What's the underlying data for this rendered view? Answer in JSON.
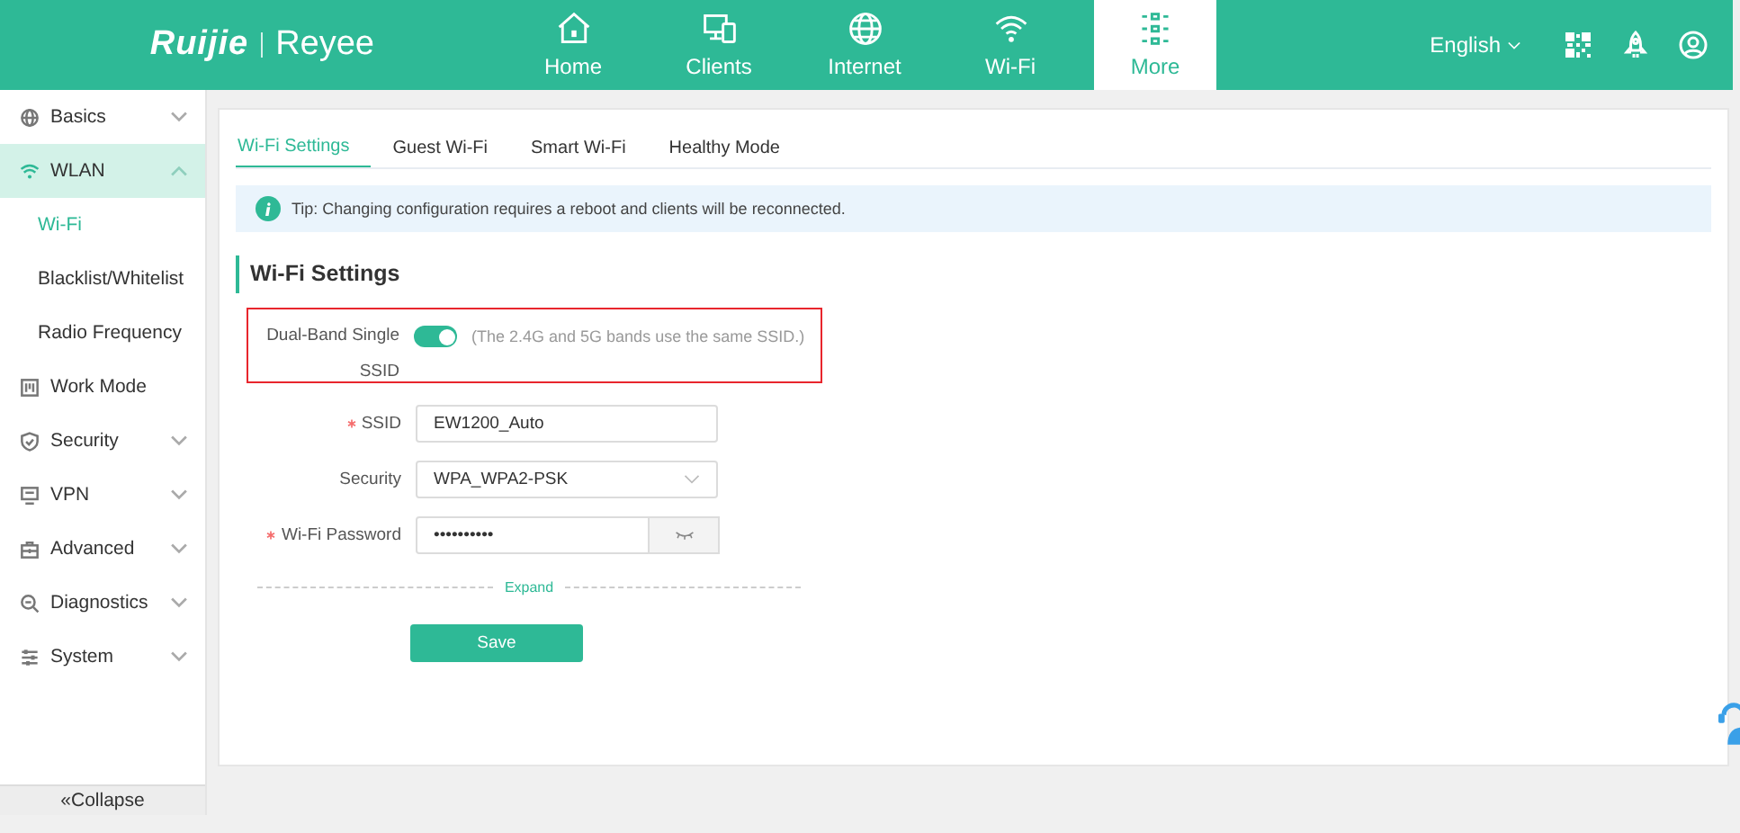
{
  "header": {
    "logo": {
      "brand": "Ruijie",
      "sub": "Reyee"
    },
    "nav": [
      {
        "label": "Home",
        "selected": false
      },
      {
        "label": "Clients",
        "selected": false
      },
      {
        "label": "Internet",
        "selected": false
      },
      {
        "label": "Wi-Fi",
        "selected": false
      },
      {
        "label": "More",
        "selected": true
      }
    ],
    "language": "English"
  },
  "sidebar": {
    "items": [
      {
        "label": "Basics",
        "kind": "group",
        "expanded": false,
        "selected": false
      },
      {
        "label": "WLAN",
        "kind": "group",
        "expanded": true,
        "selected": true,
        "children": [
          {
            "label": "Wi-Fi",
            "selected": true
          },
          {
            "label": "Blacklist/Whitelist",
            "selected": false
          },
          {
            "label": "Radio Frequency",
            "selected": false
          }
        ]
      },
      {
        "label": "Work Mode",
        "kind": "link",
        "selected": false
      },
      {
        "label": "Security",
        "kind": "group",
        "expanded": false,
        "selected": false
      },
      {
        "label": "VPN",
        "kind": "group",
        "expanded": false,
        "selected": false
      },
      {
        "label": "Advanced",
        "kind": "group",
        "expanded": false,
        "selected": false
      },
      {
        "label": "Diagnostics",
        "kind": "group",
        "expanded": false,
        "selected": false
      },
      {
        "label": "System",
        "kind": "group",
        "expanded": false,
        "selected": false
      }
    ],
    "collapse": "«Collapse"
  },
  "content": {
    "tabs": [
      {
        "label": "Wi-Fi Settings",
        "selected": true
      },
      {
        "label": "Guest Wi-Fi",
        "selected": false
      },
      {
        "label": "Smart Wi-Fi",
        "selected": false
      },
      {
        "label": "Healthy Mode",
        "selected": false
      }
    ],
    "tip": "Tip: Changing configuration requires a reboot and clients will be reconnected.",
    "section_title": "Wi-Fi Settings",
    "fields": [
      {
        "kind": "toggle",
        "label": "Dual-Band Single SSID",
        "required": false,
        "highlighted": true,
        "on": true,
        "hint": "(The 2.4G and 5G bands use the same SSID.)"
      },
      {
        "kind": "text",
        "label": "SSID",
        "required": true,
        "highlighted": false,
        "value": "EW1200_Auto"
      },
      {
        "kind": "select",
        "label": "Security",
        "required": false,
        "highlighted": false,
        "value": "WPA_WPA2-PSK"
      },
      {
        "kind": "password",
        "label": "Wi-Fi Password",
        "required": true,
        "highlighted": false,
        "value": "••••••••••"
      }
    ],
    "expand": "Expand",
    "save": "Save"
  }
}
